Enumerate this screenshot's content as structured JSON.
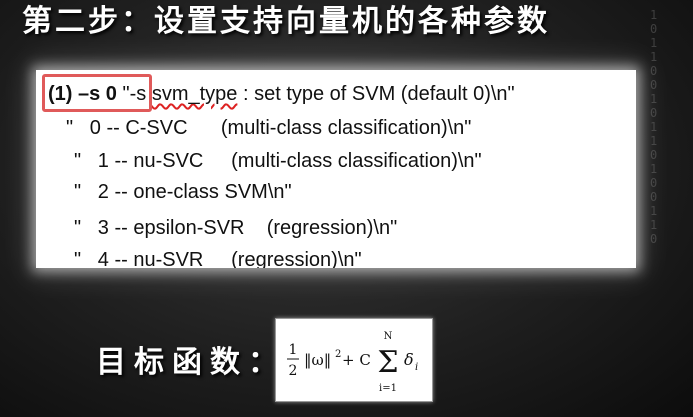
{
  "slide": {
    "title": "第二步：设置支持向量机的各种参数",
    "objective_label": "目标函数：",
    "binary_deco": "1\n0\n1\n1\n0\n0\n1\n0\n1\n1\n0\n1\n0\n0\n1\n1\n0"
  },
  "code": {
    "highlight": "(1) –s 0",
    "line1_rest": " \"-s svm_type : set type of SVM (default 0)\\n\"",
    "options": [
      "\"   0 -- C-SVC      (multi-class classification)\\n\"",
      "\"   1 -- nu-SVC     (multi-class classification)\\n\"",
      "\"   2 -- one-class SVM\\n\"",
      "\"   3 -- epsilon-SVR    (regression)\\n\"",
      "\"   4 -- nu-SVR     (regression)\\n\""
    ]
  },
  "formula": {
    "numerator": "1",
    "denominator": "2",
    "norm": "‖ω‖",
    "exponent": "2",
    "plus_c": "+ C",
    "sigma": "Σ",
    "upper_limit": "N",
    "lower_limit": "i=1",
    "term": "δ",
    "subscript": "i"
  },
  "colors": {
    "highlight_border": "#e05a5a",
    "underline": "#d22"
  }
}
